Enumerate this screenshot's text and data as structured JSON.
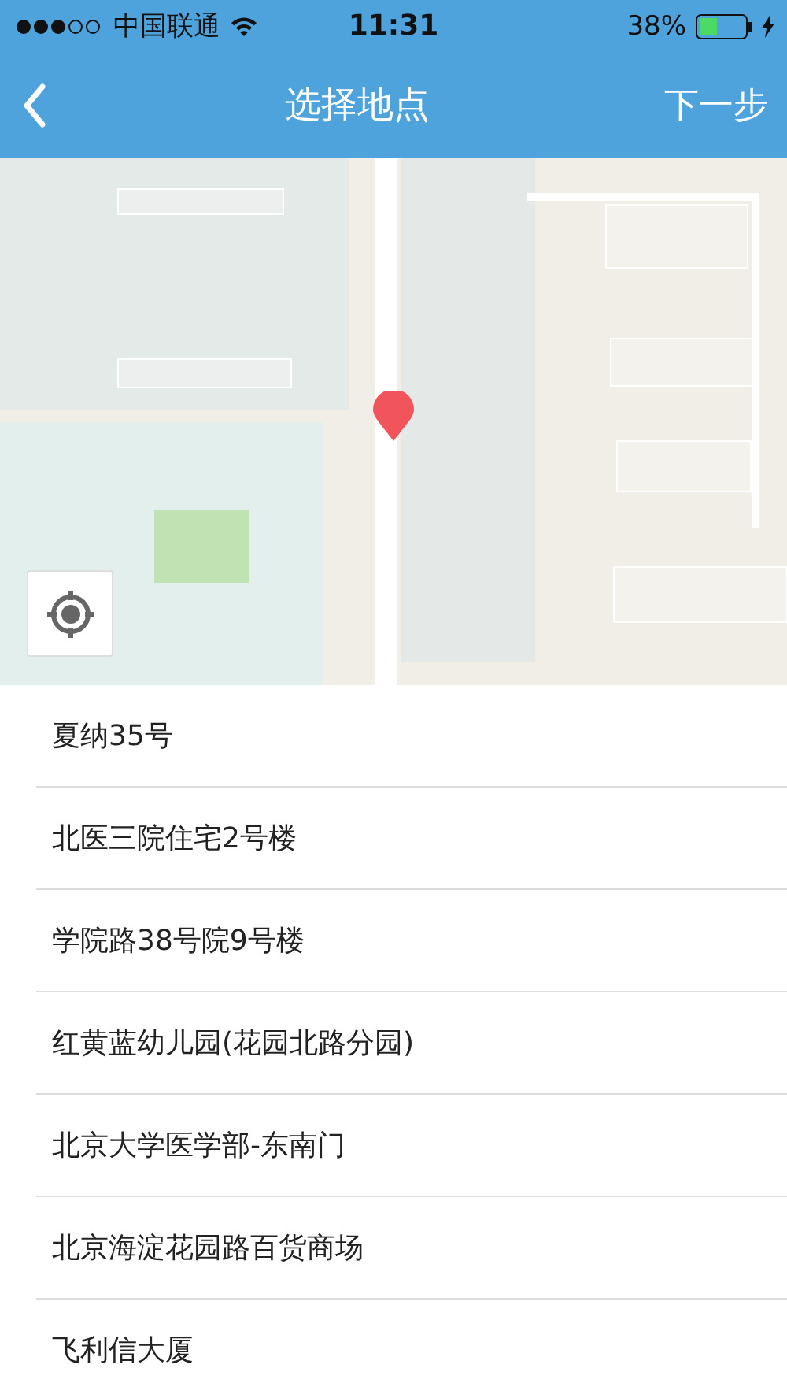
{
  "status_bar": {
    "carrier": "中国联通",
    "time": "11:31",
    "battery": "38%"
  },
  "nav_bar": {
    "title": "选择地点",
    "next": "下一步"
  },
  "places": [
    {
      "name": "夏纳35号"
    },
    {
      "name": "北医三院住宅2号楼"
    },
    {
      "name": "学院路38号院9号楼"
    },
    {
      "name": "红黄蓝幼儿园(花园北路分园)"
    },
    {
      "name": "北京大学医学部-东南门"
    },
    {
      "name": "北京海淀花园路百货商场"
    },
    {
      "name": "飞利信大厦"
    }
  ]
}
